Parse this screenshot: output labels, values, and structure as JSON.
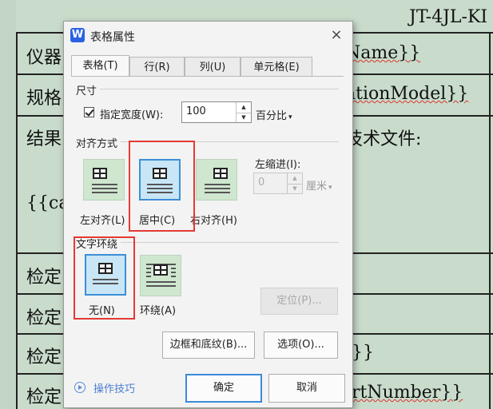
{
  "document": {
    "doc_id": "JT-4JL-KI",
    "rows": [
      {
        "label": "仪器",
        "value": "Name}}"
      },
      {
        "label": "规格",
        "value": "ationModel}}"
      },
      {
        "label": "结果",
        "value": "技术文件:"
      },
      {
        "label": "",
        "value": "{{ca"
      },
      {
        "label": "检定",
        "value": ""
      },
      {
        "label": "检定",
        "value": ""
      },
      {
        "label": "检定",
        "value": "}}"
      },
      {
        "label": "检定",
        "value": "rtNumber}}"
      }
    ]
  },
  "dialog": {
    "app_logo": "W",
    "title": "表格属性",
    "close_icon": "×",
    "tabs": [
      {
        "label": "表格(T)",
        "active": true
      },
      {
        "label": "行(R)",
        "active": false
      },
      {
        "label": "列(U)",
        "active": false
      },
      {
        "label": "单元格(E)",
        "active": false
      }
    ],
    "size": {
      "group_label": "尺寸",
      "specify_width_label": "指定宽度(W):",
      "specify_width_checked": true,
      "width_value": "100",
      "width_unit": "百分比"
    },
    "alignment": {
      "group_label": "对齐方式",
      "options": [
        {
          "label": "左对齐(L)",
          "selected": false
        },
        {
          "label": "居中(C)",
          "selected": true
        },
        {
          "label": "右对齐(H)",
          "selected": false
        }
      ],
      "indent_label": "左缩进(I):",
      "indent_value": "0",
      "indent_unit": "厘米"
    },
    "wrapping": {
      "group_label": "文字环绕",
      "options": [
        {
          "label": "无(N)",
          "selected": true
        },
        {
          "label": "环绕(A)",
          "selected": false
        }
      ],
      "position_button": "定位(P)..."
    },
    "borders_button": "边框和底纹(B)...",
    "options_button": "选项(O)...",
    "tips_label": "操作技巧",
    "ok_button": "确定",
    "cancel_button": "取消"
  },
  "colors": {
    "document_bg": "#c9dccb",
    "accent_blue": "#3a8ad8",
    "highlight_red": "#e53935",
    "option_bg": "#cfe6cf"
  }
}
